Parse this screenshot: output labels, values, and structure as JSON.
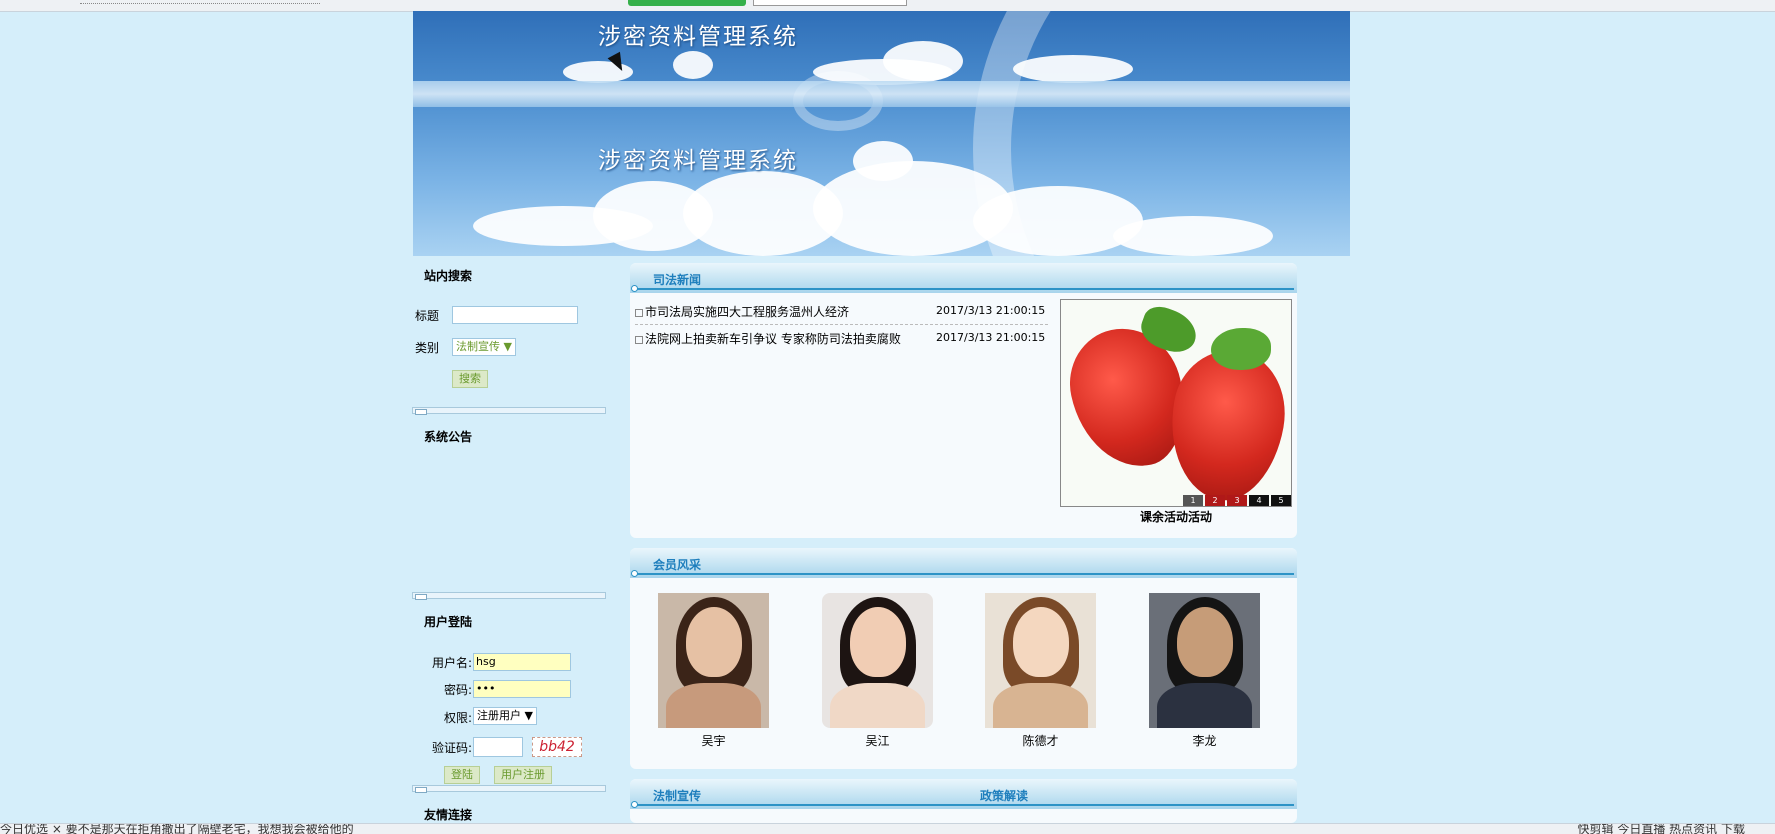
{
  "header": {
    "banner_title_top": "涉密资料管理系统",
    "banner_title_main": "涉密资料管理系统"
  },
  "sidebar": {
    "search": {
      "heading": "站内搜索",
      "title_label": "标题",
      "title_value": "",
      "category_label": "类别",
      "category_selected": "法制宣传",
      "search_button": "搜索"
    },
    "notice": {
      "heading": "系统公告"
    },
    "login": {
      "heading": "用户登陆",
      "username_label": "用户名:",
      "username_value": "hsg",
      "password_label": "密码:",
      "password_value": "•••",
      "role_label": "权限:",
      "role_selected": "注册用户",
      "captcha_label": "验证码:",
      "captcha_value": "",
      "captcha_image_text": "bb42",
      "login_button": "登陆",
      "register_button": "用户注册"
    },
    "links": {
      "heading": "友情连接"
    }
  },
  "news": {
    "heading": "司法新闻",
    "items": [
      {
        "title": "市司法局实施四大工程服务温州人经济",
        "date": "2017/3/13 21:00:15"
      },
      {
        "title": "法院网上拍卖新车引争议 专家称防司法拍卖腐败",
        "date": "2017/3/13 21:00:15"
      }
    ],
    "slideshow_caption": "课余活动活动",
    "pager": [
      "1",
      "2",
      "3",
      "4",
      "5"
    ]
  },
  "members": {
    "heading": "会员风采",
    "people": [
      {
        "name": "吴宇"
      },
      {
        "name": "吴江"
      },
      {
        "name": "陈德才"
      },
      {
        "name": "李龙"
      }
    ]
  },
  "bottom_sections": {
    "left_heading": "法制宣传",
    "right_heading": "政策解读"
  },
  "statusbar": {
    "left_text": "今日优选   ×  要不是那天在拒角撒出了隔壁老宅，我想我会被给他的",
    "right_text": "快剪辑   今日直播   热点资讯          下载"
  }
}
